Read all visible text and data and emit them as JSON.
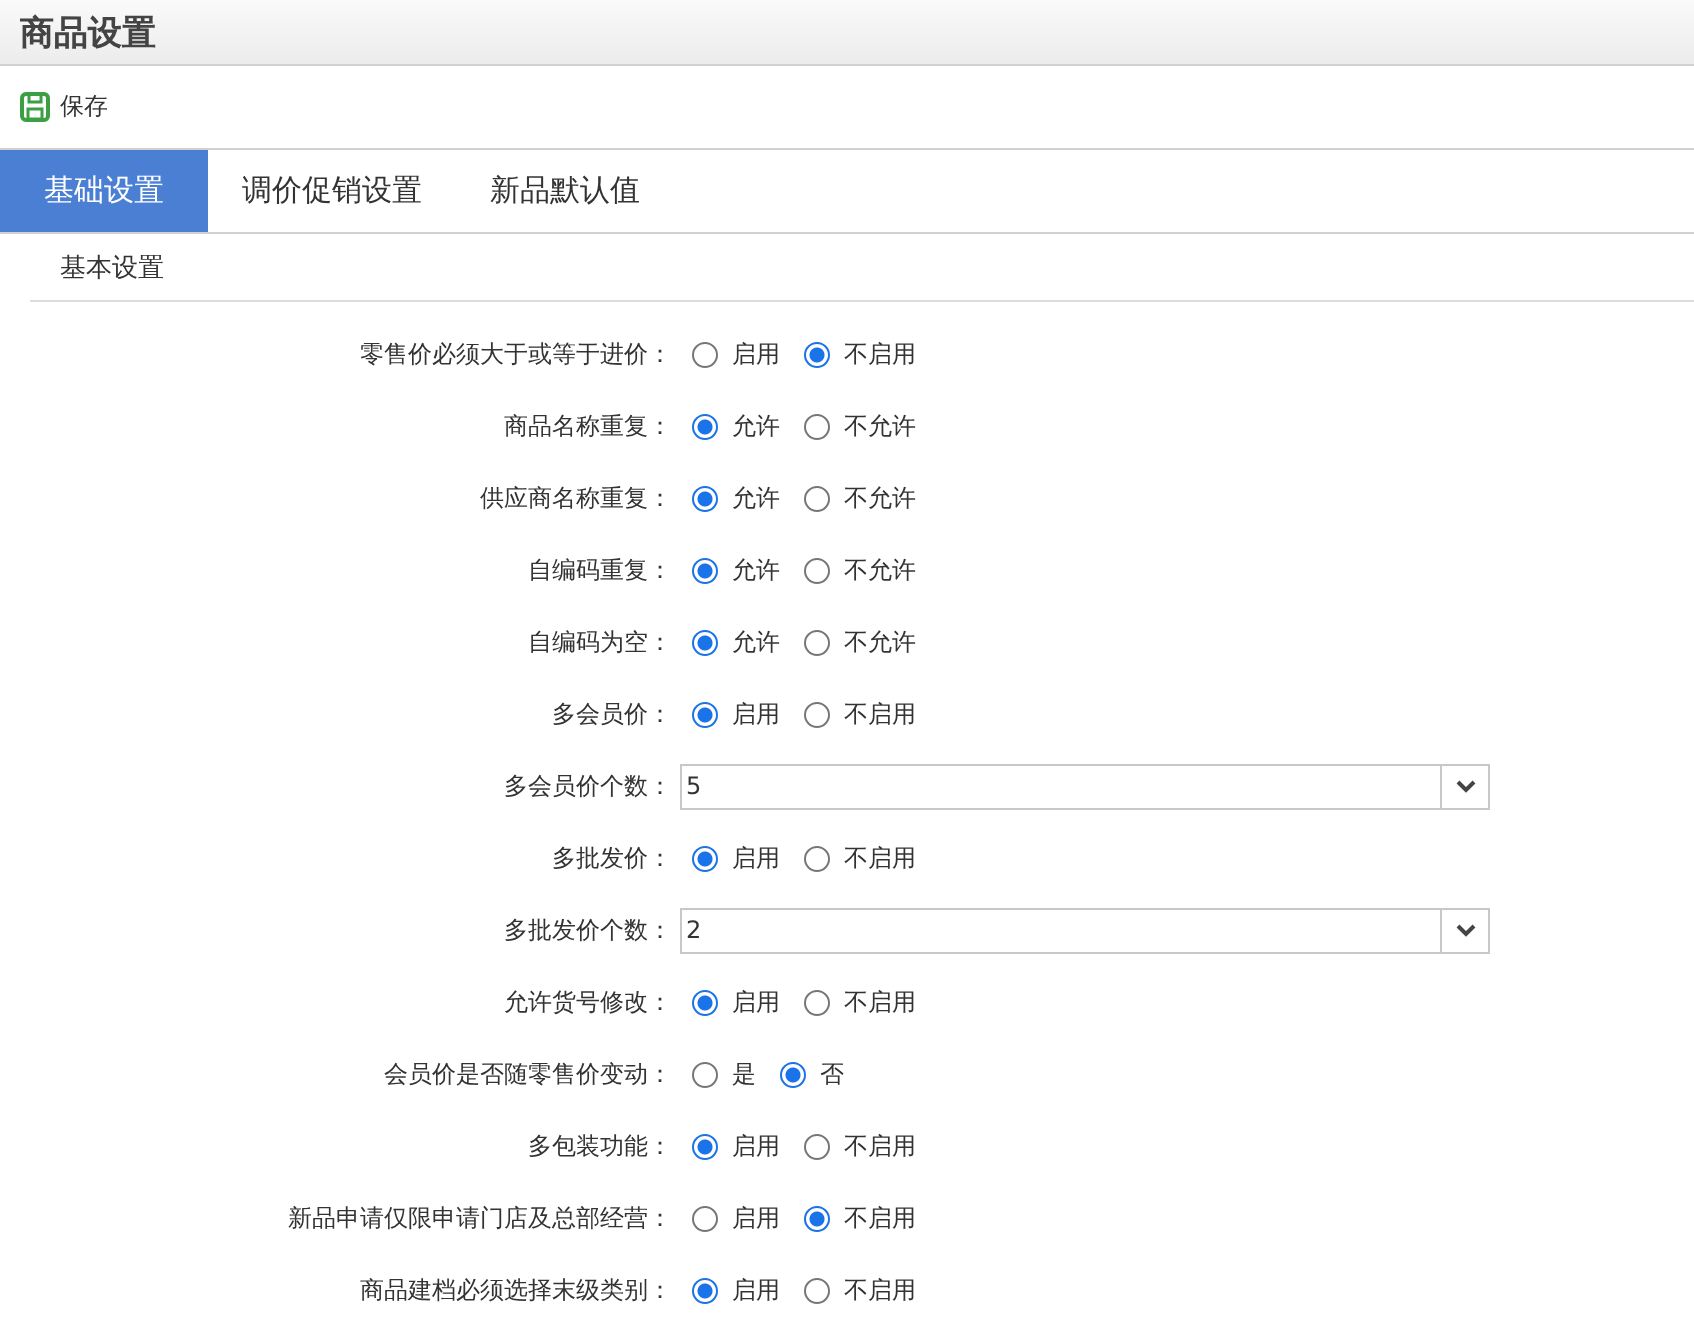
{
  "window": {
    "title": "商品设置"
  },
  "toolbar": {
    "save_label": "保存"
  },
  "tabs": [
    {
      "label": "基础设置",
      "selected": true
    },
    {
      "label": "调价促销设置",
      "selected": false
    },
    {
      "label": "新品默认值",
      "selected": false
    }
  ],
  "section": {
    "title": "基本设置"
  },
  "rows": [
    {
      "kind": "radio",
      "label": "零售价必须大于或等于进价：",
      "options": [
        {
          "label": "启用",
          "selected": false
        },
        {
          "label": "不启用",
          "selected": true
        }
      ]
    },
    {
      "kind": "radio",
      "label": "商品名称重复：",
      "options": [
        {
          "label": "允许",
          "selected": true
        },
        {
          "label": "不允许",
          "selected": false
        }
      ]
    },
    {
      "kind": "radio",
      "label": "供应商名称重复：",
      "options": [
        {
          "label": "允许",
          "selected": true
        },
        {
          "label": "不允许",
          "selected": false
        }
      ]
    },
    {
      "kind": "radio",
      "label": "自编码重复：",
      "options": [
        {
          "label": "允许",
          "selected": true
        },
        {
          "label": "不允许",
          "selected": false
        }
      ]
    },
    {
      "kind": "radio",
      "label": "自编码为空：",
      "options": [
        {
          "label": "允许",
          "selected": true
        },
        {
          "label": "不允许",
          "selected": false
        }
      ]
    },
    {
      "kind": "radio",
      "label": "多会员价：",
      "options": [
        {
          "label": "启用",
          "selected": true
        },
        {
          "label": "不启用",
          "selected": false
        }
      ]
    },
    {
      "kind": "select",
      "label": "多会员价个数：",
      "value": "5"
    },
    {
      "kind": "radio",
      "label": "多批发价：",
      "options": [
        {
          "label": "启用",
          "selected": true
        },
        {
          "label": "不启用",
          "selected": false
        }
      ]
    },
    {
      "kind": "select",
      "label": "多批发价个数：",
      "value": "2"
    },
    {
      "kind": "radio",
      "label": "允许货号修改：",
      "options": [
        {
          "label": "启用",
          "selected": true
        },
        {
          "label": "不启用",
          "selected": false
        }
      ]
    },
    {
      "kind": "radio",
      "label": "会员价是否随零售价变动：",
      "options": [
        {
          "label": "是",
          "selected": false
        },
        {
          "label": "否",
          "selected": true
        }
      ]
    },
    {
      "kind": "radio",
      "label": "多包装功能：",
      "options": [
        {
          "label": "启用",
          "selected": true
        },
        {
          "label": "不启用",
          "selected": false
        }
      ]
    },
    {
      "kind": "radio",
      "label": "新品申请仅限申请门店及总部经营：",
      "options": [
        {
          "label": "启用",
          "selected": false
        },
        {
          "label": "不启用",
          "selected": true
        }
      ]
    },
    {
      "kind": "radio",
      "label": "商品建档必须选择末级类别：",
      "options": [
        {
          "label": "启用",
          "selected": true
        },
        {
          "label": "不启用",
          "selected": false
        }
      ]
    }
  ]
}
